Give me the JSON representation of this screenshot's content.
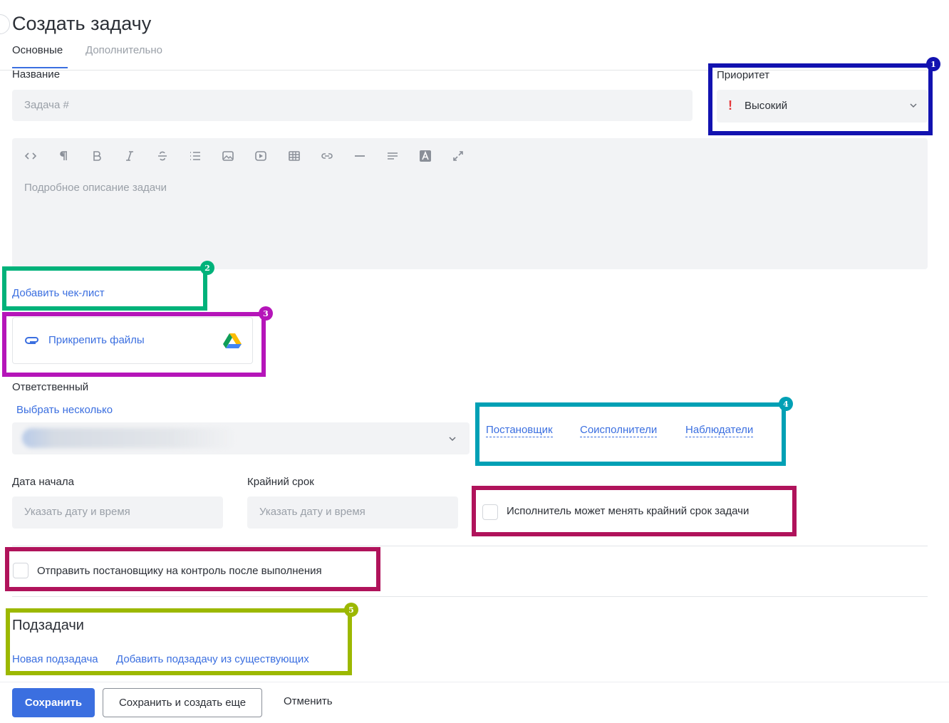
{
  "header": {
    "title": "Создать задачу",
    "tabs": [
      {
        "label": "Основные",
        "active": true
      },
      {
        "label": "Дополнительно",
        "active": false
      }
    ]
  },
  "name_field": {
    "label": "Название",
    "placeholder": "Задача #"
  },
  "priority": {
    "label": "Приоритет",
    "value": "Высокий",
    "icon": "exclamation-icon",
    "icon_color": "#e5383b"
  },
  "editor": {
    "placeholder": "Подробное описание задачи",
    "toolbar": [
      "code-icon",
      "paragraph-icon",
      "bold-icon",
      "italic-icon",
      "strikethrough-icon",
      "list-icon",
      "image-icon",
      "video-icon",
      "table-icon",
      "link-icon",
      "horizontal-rule-icon",
      "align-icon",
      "font-color-icon",
      "fullscreen-icon"
    ]
  },
  "checklist": {
    "label": "Добавить чек-лист"
  },
  "attach": {
    "label": "Прикрепить файлы"
  },
  "responsible": {
    "label": "Ответственный",
    "multi_link": "Выбрать несколько"
  },
  "roles": {
    "creator": "Постановщик",
    "coexecutors": "Соисполнители",
    "observers": "Наблюдатели"
  },
  "dates": {
    "start_label": "Дата начала",
    "start_placeholder": "Указать дату и время",
    "deadline_label": "Крайний срок",
    "deadline_placeholder": "Указать дату и время",
    "change_deadline": "Исполнитель может менять крайний срок задачи"
  },
  "control": {
    "label": "Отправить постановщику на контроль после выполнения"
  },
  "subtasks": {
    "title": "Подзадачи",
    "new": "Новая подзадача",
    "from_existing": "Добавить подзадачу из существующих"
  },
  "footer": {
    "save": "Сохранить",
    "save_more": "Сохранить и создать еще",
    "cancel": "Отменить"
  },
  "annotations": [
    {
      "number": "1",
      "color": "#1212b0"
    },
    {
      "number": "2",
      "color": "#00b27a"
    },
    {
      "number": "3",
      "color": "#b515b9"
    },
    {
      "number": "4",
      "color": "#00a0b5"
    },
    {
      "number": "5",
      "color": "#9cb800"
    }
  ],
  "annotation_red_color": "#b0135b",
  "accent_color": "#3b6fe0"
}
